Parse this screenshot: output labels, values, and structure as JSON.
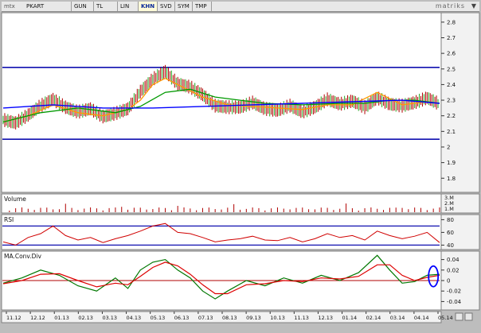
{
  "toolbar": {
    "logo": "mtx",
    "symbol": "PKART",
    "buttons": [
      "GUN",
      "TL",
      "LIN",
      "KHN",
      "SVD",
      "SYM",
      "TMP"
    ],
    "active_button": "KHN",
    "brand": "matriks"
  },
  "colors": {
    "price": "#b00000",
    "ma_short": "#ff9900",
    "ma_mid": "#009900",
    "ma_long": "#0000ff",
    "channel": "#1010b0",
    "rsi": "#d00000",
    "macd": "#007700",
    "signal": "#dd0000",
    "highlight": "#0000ff"
  },
  "chart_data": [
    {
      "type": "line",
      "panel": "price",
      "title": "",
      "yticks": [
        1.8,
        1.9,
        2,
        2.1,
        2.2,
        2.3,
        2.4,
        2.5,
        2.6,
        2.7,
        2.8
      ],
      "ylim": [
        1.73,
        2.84
      ],
      "xlim": [
        0,
        350
      ],
      "channel_lines": [
        2.51,
        2.05
      ],
      "series": [
        {
          "role": "price",
          "x": [
            0,
            10,
            20,
            30,
            40,
            50,
            60,
            70,
            80,
            90,
            100,
            110,
            120,
            130,
            140,
            150,
            160,
            170,
            180,
            190,
            200,
            210,
            220,
            230,
            240,
            250,
            260,
            270,
            280,
            290,
            300,
            310,
            320,
            330,
            340,
            350
          ],
          "values": [
            2.17,
            2.15,
            2.2,
            2.26,
            2.3,
            2.25,
            2.22,
            2.24,
            2.19,
            2.21,
            2.24,
            2.35,
            2.43,
            2.48,
            2.4,
            2.38,
            2.33,
            2.26,
            2.25,
            2.25,
            2.28,
            2.24,
            2.23,
            2.26,
            2.22,
            2.25,
            2.3,
            2.27,
            2.29,
            2.25,
            2.31,
            2.27,
            2.26,
            2.28,
            2.31,
            2.27
          ]
        },
        {
          "role": "ma_short",
          "x": [
            0,
            20,
            40,
            60,
            80,
            100,
            110,
            120,
            130,
            140,
            160,
            180,
            200,
            220,
            240,
            260,
            280,
            300,
            310,
            320,
            340,
            350
          ],
          "values": [
            2.16,
            2.2,
            2.27,
            2.22,
            2.2,
            2.24,
            2.3,
            2.4,
            2.44,
            2.4,
            2.32,
            2.27,
            2.26,
            2.25,
            2.24,
            2.27,
            2.27,
            2.35,
            2.31,
            2.27,
            2.29,
            2.28
          ]
        },
        {
          "role": "ma_mid",
          "x": [
            0,
            30,
            60,
            90,
            110,
            130,
            150,
            170,
            190,
            210,
            240,
            270,
            290,
            310,
            330,
            350
          ],
          "values": [
            2.16,
            2.22,
            2.25,
            2.22,
            2.26,
            2.35,
            2.37,
            2.32,
            2.3,
            2.28,
            2.27,
            2.28,
            2.28,
            2.3,
            2.3,
            2.28
          ]
        },
        {
          "role": "ma_long",
          "x": [
            0,
            40,
            80,
            120,
            160,
            200,
            240,
            280,
            320,
            350
          ],
          "values": [
            2.25,
            2.27,
            2.25,
            2.25,
            2.26,
            2.27,
            2.28,
            2.29,
            2.3,
            2.28
          ]
        }
      ]
    },
    {
      "type": "bar",
      "panel": "volume",
      "title": "Volume",
      "yticks": [
        "3.M",
        "2.M",
        "1.M"
      ]
    },
    {
      "type": "line",
      "panel": "rsi",
      "title": "RSI",
      "yticks": [
        40,
        60,
        80
      ],
      "ylim": [
        33,
        88
      ],
      "levels": [
        70,
        40
      ],
      "series": [
        {
          "role": "rsi",
          "x": [
            0,
            10,
            20,
            30,
            40,
            50,
            60,
            70,
            80,
            90,
            100,
            110,
            120,
            130,
            140,
            150,
            160,
            170,
            180,
            190,
            200,
            210,
            220,
            230,
            240,
            250,
            260,
            270,
            280,
            290,
            300,
            310,
            320,
            330,
            340,
            350
          ],
          "values": [
            45,
            40,
            52,
            58,
            70,
            55,
            48,
            52,
            44,
            50,
            55,
            62,
            70,
            74,
            60,
            58,
            52,
            45,
            48,
            50,
            54,
            48,
            47,
            52,
            45,
            50,
            58,
            52,
            55,
            48,
            62,
            55,
            50,
            54,
            60,
            44
          ]
        }
      ]
    },
    {
      "type": "line",
      "panel": "macd",
      "title": "MA.Conv.Div",
      "yticks": [
        0.04,
        0.02,
        0,
        -0.02,
        -0.04
      ],
      "ylim": [
        -0.05,
        0.05
      ],
      "series": [
        {
          "role": "macd",
          "x": [
            0,
            15,
            30,
            45,
            60,
            75,
            90,
            100,
            110,
            120,
            130,
            140,
            150,
            160,
            170,
            180,
            195,
            210,
            225,
            240,
            255,
            270,
            285,
            300,
            310,
            320,
            330,
            340,
            350
          ],
          "values": [
            -0.005,
            0.005,
            0.02,
            0.01,
            -0.01,
            -0.02,
            0.005,
            -0.015,
            0.02,
            0.035,
            0.04,
            0.02,
            0.005,
            -0.02,
            -0.035,
            -0.02,
            0.0,
            -0.01,
            0.005,
            -0.005,
            0.01,
            0.0,
            0.015,
            0.048,
            0.02,
            -0.005,
            -0.002,
            0.01,
            0.012
          ]
        },
        {
          "role": "signal",
          "x": [
            0,
            15,
            30,
            45,
            60,
            75,
            90,
            100,
            110,
            120,
            130,
            140,
            150,
            160,
            170,
            180,
            195,
            210,
            225,
            240,
            255,
            270,
            285,
            300,
            310,
            320,
            330,
            340,
            350
          ],
          "values": [
            -0.006,
            0.0,
            0.012,
            0.013,
            0.0,
            -0.012,
            -0.005,
            -0.008,
            0.008,
            0.025,
            0.035,
            0.028,
            0.012,
            -0.008,
            -0.025,
            -0.025,
            -0.008,
            -0.006,
            0.0,
            -0.002,
            0.005,
            0.003,
            0.008,
            0.03,
            0.03,
            0.01,
            0.0,
            0.006,
            0.01
          ]
        }
      ]
    }
  ],
  "x_axis": {
    "labels": [
      "11.12",
      "12.12",
      "01.13",
      "02.13",
      "03.13",
      "04.13",
      "05.13",
      "06.13",
      "07.13",
      "08.13",
      "09.13",
      "10.13",
      "11.13",
      "12.13",
      "01.14",
      "02.14",
      "03.14",
      "04.14",
      "05.14"
    ]
  }
}
